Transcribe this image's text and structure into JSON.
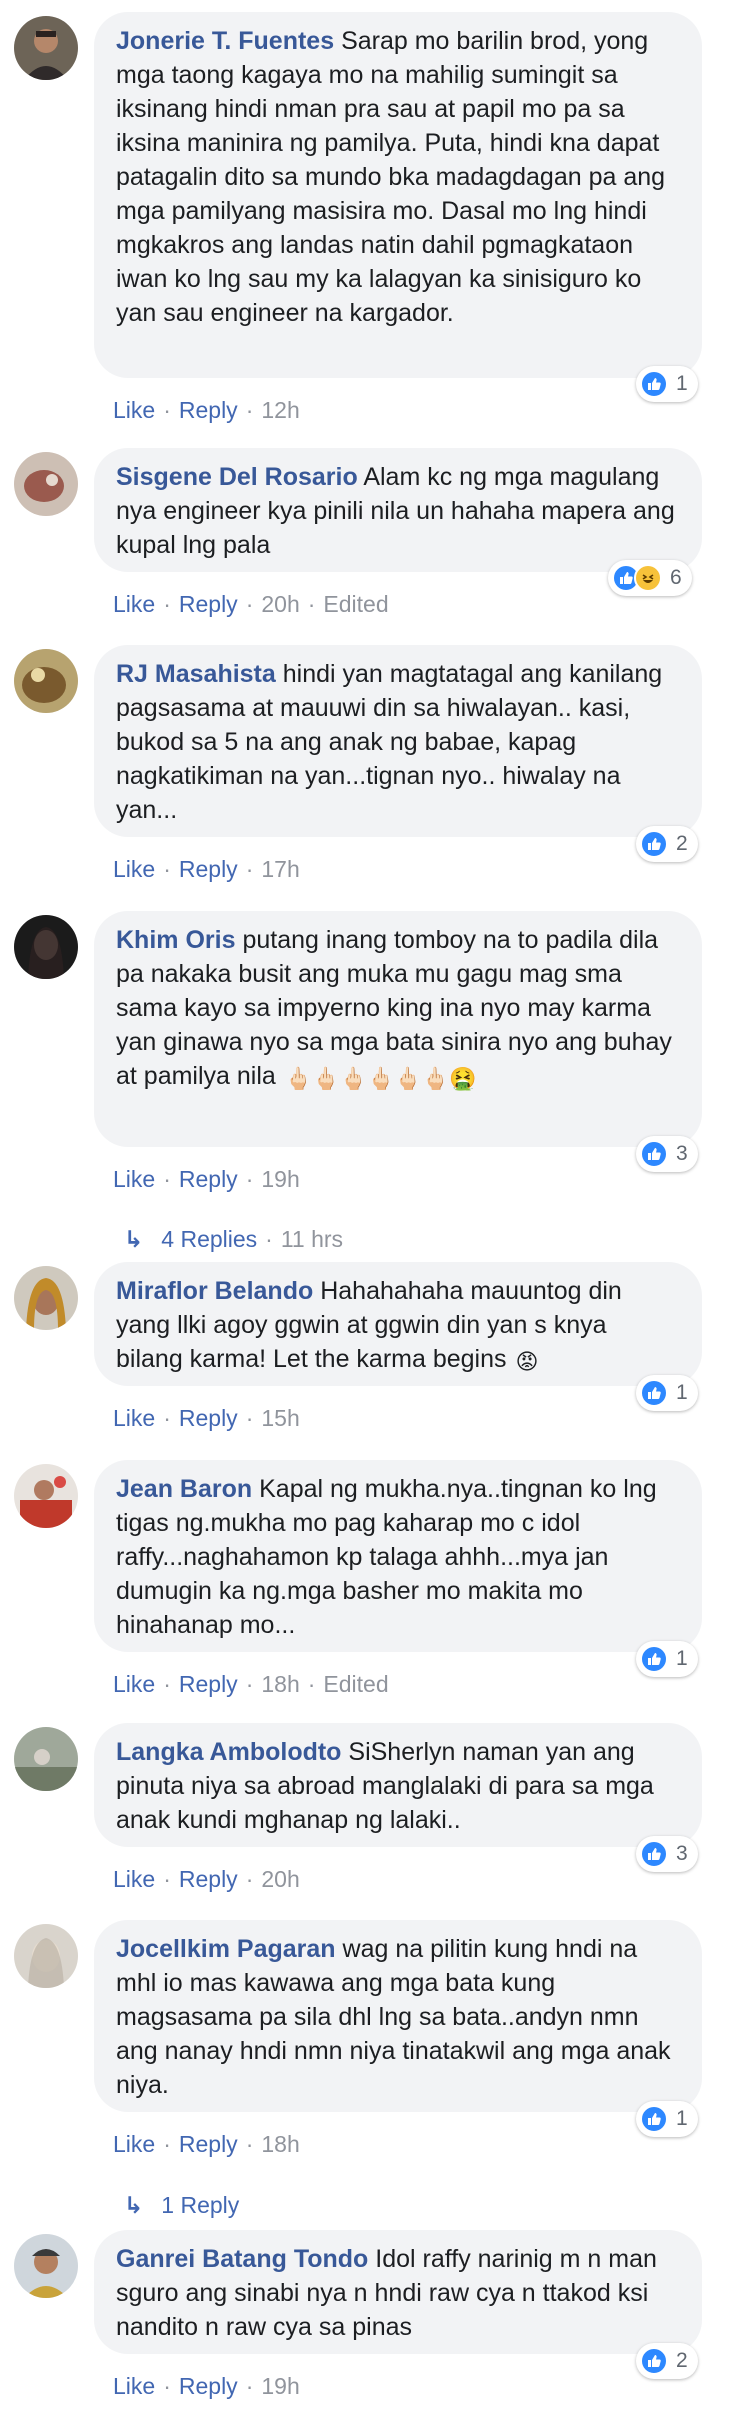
{
  "colors": {
    "author": "#385898",
    "link": "#4267b2",
    "meta": "#90949c",
    "bubble": "#f2f3f5",
    "like": "#2d88ff"
  },
  "actions": {
    "like": "Like",
    "reply": "Reply",
    "dot": "·"
  },
  "comments": [
    {
      "author": "Jonerie T. Fuentes",
      "text": "Sarap mo barilin brod, yong mga taong kagaya mo na mahilig sumingit sa iksinang hindi nman pra sau at papil mo pa sa iksina maninira ng pamilya. Puta, hindi kna dapat patagalin dito sa mundo bka madagdagan pa ang mga pamilyang masisira mo. Dasal mo lng hindi mgkakros ang landas natin dahil pgmagkataon iwan ko lng sau my ka lalagyan ka sinisiguro ko yan sau engineer na kargador.",
      "time": "12h",
      "edited": "",
      "reactions": [
        "like"
      ],
      "reaction_count": "1"
    },
    {
      "author": "Sisgene Del Rosario",
      "text": "Alam kc ng mga magulang nya engineer kya pinili nila un hahaha mapera ang kupal lng pala",
      "time": "20h",
      "edited": "Edited",
      "reactions": [
        "like",
        "haha"
      ],
      "reaction_count": "6"
    },
    {
      "author": "RJ Masahista",
      "text": "hindi yan magtatagal ang kanilang pagsasama at mauuwi din sa hiwalayan.. kasi, bukod sa 5 na ang anak ng babae, kapag nagkatikiman na yan...tignan nyo.. hiwalay na yan...",
      "time": "17h",
      "edited": "",
      "reactions": [
        "like"
      ],
      "reaction_count": "2"
    },
    {
      "author": "Khim Oris",
      "text": "putang inang tomboy na to padila dila pa nakaka busit ang muka mu gagu mag sma sama kayo sa impyerno king ina nyo may karma yan ginawa nyo sa mga bata sinira nyo ang buhay at pamilya nila",
      "emoji": "🖕🏻🖕🏻🖕🏻🖕🏻🖕🏻🖕🏻🤮",
      "time": "19h",
      "edited": "",
      "reactions": [
        "like"
      ],
      "reaction_count": "3",
      "replies": {
        "label": "4 Replies",
        "time": "11 hrs"
      }
    },
    {
      "author": "Miraflor Belando",
      "text": "Hahahahaha mauuntog din yang llki agoy ggwin at ggwin din yan s knya bilang karma! Let the karma begins",
      "emoji": "😡",
      "time": "15h",
      "edited": "",
      "reactions": [
        "like"
      ],
      "reaction_count": "1"
    },
    {
      "author": "Jean Baron",
      "text": "Kapal ng mukha.nya..tingnan ko lng tigas ng.mukha mo pag kaharap mo c idol raffy...naghahamon kp talaga ahhh...mya jan dumugin ka ng.mga basher mo makita mo hinahanap mo...",
      "time": "18h",
      "edited": "Edited",
      "reactions": [
        "like"
      ],
      "reaction_count": "1"
    },
    {
      "author": "Langka Ambolodto",
      "text": "SiSherlyn naman yan ang pinuta niya sa abroad manglalaki di para sa mga anak kundi mghanap ng lalaki..",
      "time": "20h",
      "edited": "",
      "reactions": [
        "like"
      ],
      "reaction_count": "3"
    },
    {
      "author": "Jocellkim Pagaran",
      "text": "wag na pilitin kung hndi na mhl io mas kawawa ang mga bata kung magsasama pa sila dhl lng sa bata..andyn nmn ang nanay hndi nmn niya tinatakwil ang mga anak niya.",
      "time": "18h",
      "edited": "",
      "reactions": [
        "like"
      ],
      "reaction_count": "1",
      "replies": {
        "label": "1 Reply",
        "time": ""
      }
    },
    {
      "author": "Ganrei Batang Tondo",
      "text": "Idol raffy narinig m n man sguro ang sinabi nya n hndi raw cya n ttakod ksi nandito n raw cya sa pinas",
      "time": "19h",
      "edited": "",
      "reactions": [
        "like"
      ],
      "reaction_count": "2"
    }
  ]
}
